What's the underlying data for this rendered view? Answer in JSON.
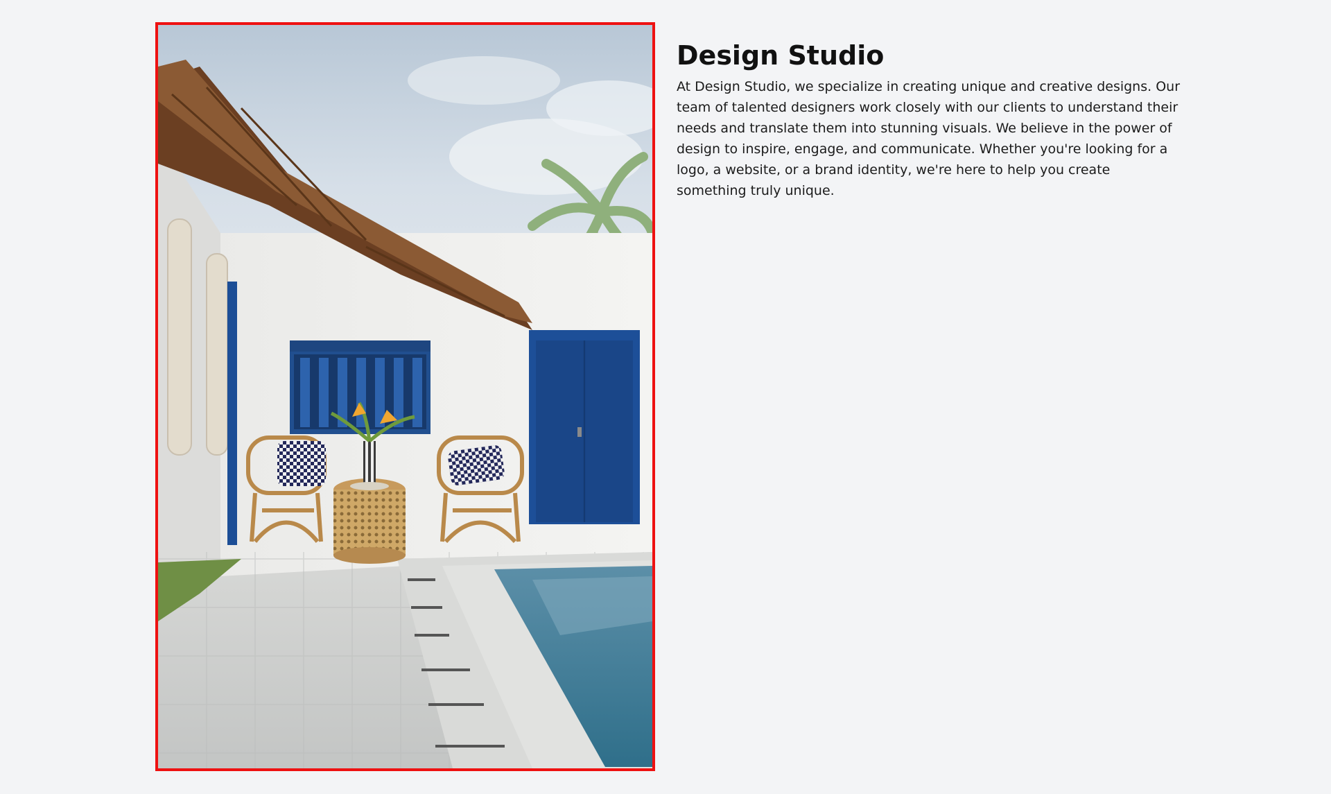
{
  "page": {
    "background": "#f3f4f6",
    "frame_color": "#ee1111"
  },
  "hero_image": {
    "subject": "white villa patio with blue shutters, rattan chairs and pool"
  },
  "studio": {
    "title": "Design Studio",
    "description": "At Design Studio, we specialize in creating unique and creative designs. Our team of talented designers work closely with our clients to understand their needs and translate them into stunning visuals. We believe in the power of design to inspire, engage, and communicate. Whether you're looking for a logo, a website, or a brand identity, we're here to help you create something truly unique."
  }
}
